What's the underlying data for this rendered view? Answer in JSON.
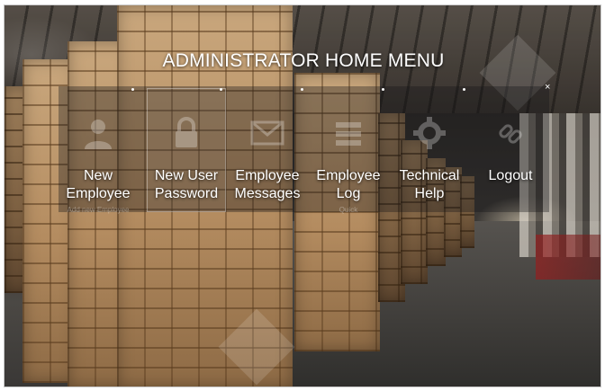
{
  "page": {
    "title": "ADMINISTRATOR HOME MENU",
    "close_glyph": "×"
  },
  "menu": {
    "items": [
      {
        "label_line1": "New",
        "label_line2": "Employee",
        "sub": "Add new Employee",
        "icon": "user-icon"
      },
      {
        "label_line1": "New User",
        "label_line2": "Password",
        "sub": "",
        "icon": "lock-icon"
      },
      {
        "label_line1": "Employee",
        "label_line2": "Messages",
        "sub": "",
        "icon": "envelope-icon"
      },
      {
        "label_line1": "Employee",
        "label_line2": "Log",
        "sub": "Quick",
        "icon": "log-icon"
      },
      {
        "label_line1": "Technical",
        "label_line2": "Help",
        "sub": "",
        "icon": "gear-icon"
      },
      {
        "label_line1": "Logout",
        "label_line2": "",
        "sub": "",
        "icon": "link-icon"
      }
    ]
  },
  "colors": {
    "text": "#ffffff",
    "panel": "#141416"
  }
}
